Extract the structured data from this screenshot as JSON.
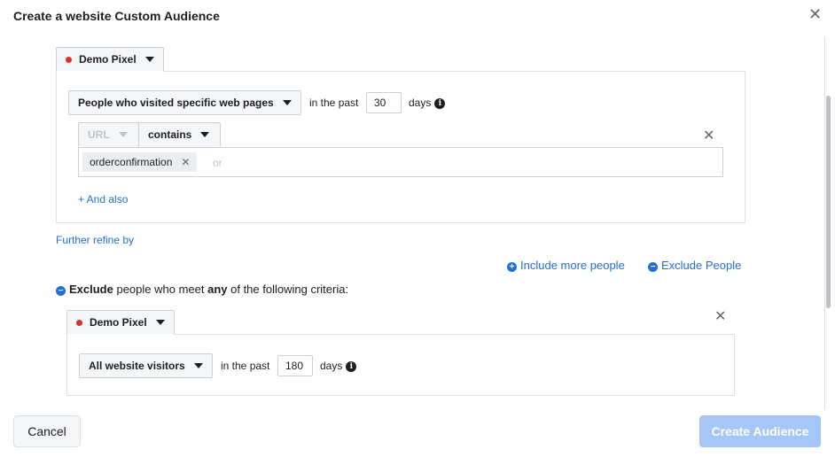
{
  "dialog": {
    "title": "Create a website Custom Audience",
    "close_glyph": "✕"
  },
  "include_block": {
    "pixel_label": "Demo Pixel",
    "rule_label": "People who visited specific web pages",
    "in_the_past": "in the past",
    "days_value": "30",
    "days_label": "days",
    "url_label": "URL",
    "contains_label": "contains",
    "url_tag": "orderconfirmation",
    "or_placeholder": "or",
    "and_also": "+ And also",
    "remove_glyph": "✕"
  },
  "further_refine": "Further refine by",
  "actions": {
    "include_more": "Include more people",
    "exclude_people": "Exclude People"
  },
  "exclude_block": {
    "heading_bold": "Exclude",
    "heading_mid": " people who meet ",
    "heading_any": "any",
    "heading_end": " of the following criteria:",
    "pixel_label": "Demo Pixel",
    "rule_label": "All website visitors",
    "in_the_past": "in the past",
    "days_value": "180",
    "days_label": "days",
    "remove_glyph": "✕"
  },
  "footer": {
    "cancel": "Cancel",
    "create": "Create Audience"
  },
  "colors": {
    "link": "#216fdb",
    "pixel_dot": "#d93025",
    "create_disabled": "#a6c7f5"
  }
}
